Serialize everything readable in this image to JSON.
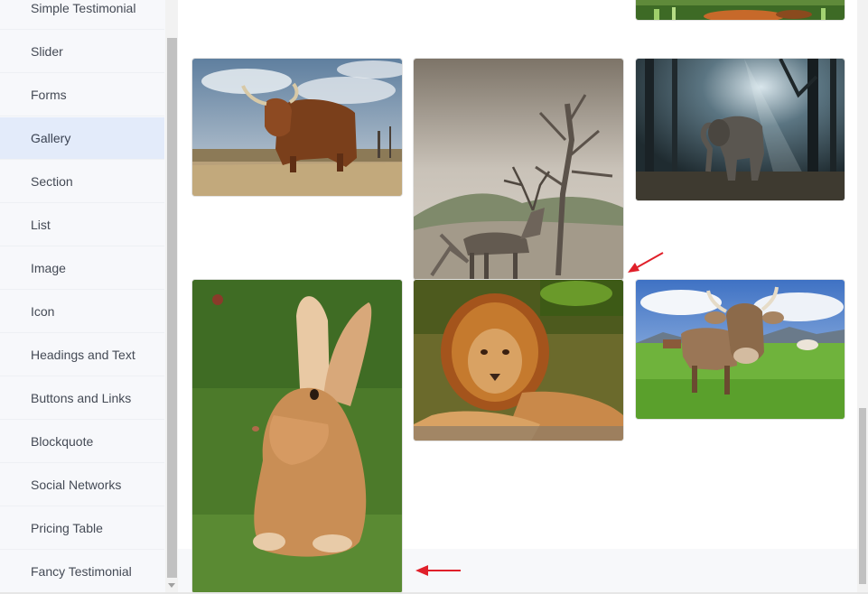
{
  "sidebar": {
    "items": [
      {
        "label": "Simple Testimonial"
      },
      {
        "label": "Slider"
      },
      {
        "label": "Forms"
      },
      {
        "label": "Gallery",
        "active": true
      },
      {
        "label": "Section"
      },
      {
        "label": "List"
      },
      {
        "label": "Image"
      },
      {
        "label": "Icon"
      },
      {
        "label": "Headings and Text"
      },
      {
        "label": "Buttons and Links"
      },
      {
        "label": "Blockquote"
      },
      {
        "label": "Social Networks"
      },
      {
        "label": "Pricing Table"
      },
      {
        "label": "Fancy Testimonial"
      }
    ]
  },
  "gallery": {
    "images": [
      {
        "subject": "fox-in-grass (partially visible)"
      },
      {
        "subject": "highland-cattle"
      },
      {
        "subject": "deer-under-tree"
      },
      {
        "subject": "elephant-in-forest"
      },
      {
        "subject": "rabbit-on-grass"
      },
      {
        "subject": "lion-resting"
      },
      {
        "subject": "cow-in-meadow"
      }
    ]
  },
  "colors": {
    "sidebar_bg": "#f7f8fb",
    "active_item_bg": "#e3ebfa",
    "annotation_arrow": "#e0202a"
  }
}
